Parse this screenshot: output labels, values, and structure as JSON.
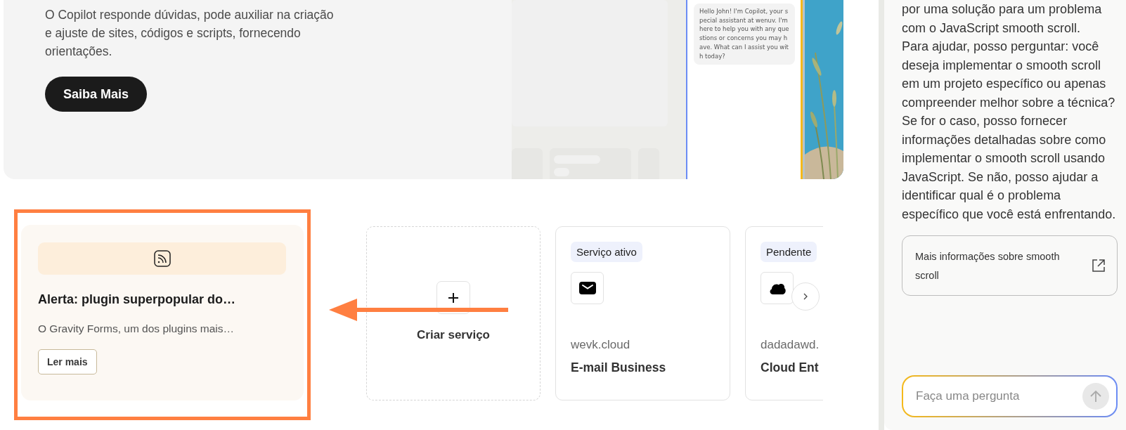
{
  "hero": {
    "description": "O Copilot responde dúvidas, pode auxiliar na criação e ajuste de sites, códigos e scripts, fornecendo orientações.",
    "button": "Saiba Mais",
    "chat_message": "Hello John! I'm Copilot, your special assistant at wenuv. I'm here to help you with any questions or concerns you may have. What can I assist you with today?"
  },
  "news_card": {
    "title": "Alerta: plugin superpopular do…",
    "excerpt": "O Gravity Forms, um dos plugins mais…",
    "button": "Ler mais"
  },
  "create_service": {
    "label": "Criar serviço"
  },
  "services": [
    {
      "kind": "mail",
      "status": "Serviço ativo",
      "domain": "wevk.cloud",
      "name": "E-mail Business"
    },
    {
      "kind": "cloud",
      "status": "Pendente",
      "domain": "dadadawd.",
      "name": "Cloud Ent"
    }
  ],
  "assistant": {
    "paragraphs": [
      "por uma solução para um problema com o JavaScript smooth scroll.",
      "Para ajudar, posso perguntar: você deseja implementar o smooth scroll em um projeto específico ou apenas compreender melhor sobre a técnica?",
      "Se for o caso, posso fornecer informações detalhadas sobre como implementar o smooth scroll usando JavaScript. Se não, posso ajudar a identificar qual é o problema específico que você está enfrentando."
    ],
    "link": "Mais informações sobre smooth scroll",
    "input": {
      "placeholder": "Faça uma pergunta"
    }
  }
}
